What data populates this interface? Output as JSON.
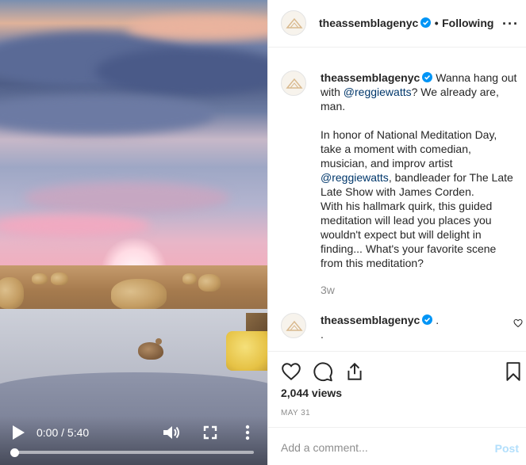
{
  "colors": {
    "accent_blue": "#0095f6",
    "post_disabled": "#b2dffc",
    "mention": "#00376b",
    "muted": "#8e8e8e",
    "text": "#262626"
  },
  "video": {
    "current_time": "0:00",
    "duration": "5:40",
    "time_label": "0:00 / 5:40",
    "progress_fraction": 0.0,
    "icons": [
      "play-icon",
      "volume-icon",
      "fullscreen-icon",
      "more-vertical-icon"
    ]
  },
  "header": {
    "username": "theassemblagenyc",
    "separator": "•",
    "follow_status": "Following",
    "more": "···"
  },
  "caption": {
    "username": "theassemblagenyc",
    "line1_text": "Wanna hang out with ",
    "mention1": "@reggiewatts",
    "line1_end": "? We already are, man.",
    "para2_start": "In honor of National Meditation Day, take a moment with comedian, musician, and improv artist ",
    "mention2": "@reggiewatts",
    "para2_end": ", bandleader for The Late Late Show with James Corden.",
    "para3": "With his hallmark quirk, this guided meditation will lead you places you wouldn't expect but will delight in finding... What's your favorite scene from this meditation?",
    "time_ago": "3w"
  },
  "comment": {
    "username": "theassemblagenyc",
    "text": ".",
    "text2": "."
  },
  "actions": {
    "icons": [
      "heart-icon",
      "comment-icon",
      "share-icon",
      "bookmark-icon"
    ],
    "views": "2,044 views",
    "date": "MAY 31"
  },
  "add_comment": {
    "placeholder": "Add a comment...",
    "post_label": "Post"
  }
}
